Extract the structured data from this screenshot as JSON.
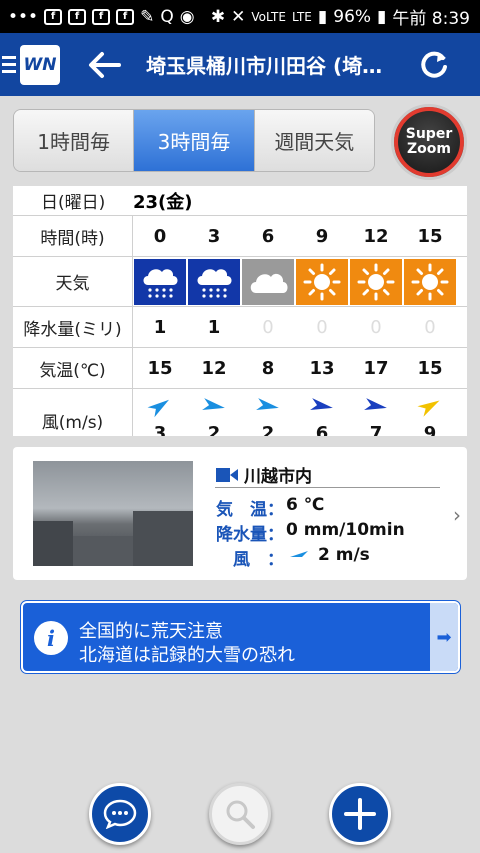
{
  "status_bar": {
    "battery": "96%",
    "time": "午前 8:39",
    "network": "LTE"
  },
  "header": {
    "title": "埼玉県桶川市川田谷 (埼玉…",
    "logo": "WN"
  },
  "tabs": [
    {
      "label": "1時間毎",
      "active": false
    },
    {
      "label": "3時間毎",
      "active": true
    },
    {
      "label": "週間天気",
      "active": false
    }
  ],
  "superzoom": {
    "line1": "Super",
    "line2": "Zoom"
  },
  "forecast": {
    "date_label": "日(曜日)",
    "date_value": "23(金)",
    "hour_label": "時間(時)",
    "hours": [
      "0",
      "3",
      "6",
      "9",
      "12",
      "15"
    ],
    "weather_label": "天気",
    "weather": [
      "rain",
      "rain",
      "cloud",
      "sun",
      "sun",
      "sun"
    ],
    "precip_label": "降水量(ミリ)",
    "precip": [
      "1",
      "1",
      "0",
      "0",
      "0",
      "0"
    ],
    "temp_label": "気温(℃)",
    "temps": [
      "15",
      "12",
      "8",
      "13",
      "17",
      "15"
    ],
    "wind_label": "風(m/s)",
    "wind": [
      "3",
      "2",
      "2",
      "6",
      "7",
      "9"
    ],
    "wind_colors": [
      "#1a8fe0",
      "#1a8fe0",
      "#1a8fe0",
      "#1a3fbf",
      "#1a3fbf",
      "#f2c200"
    ]
  },
  "webcam": {
    "place": "川越市内",
    "temp_label": "気　温：",
    "temp_value": "6 ℃",
    "precip_label": "降水量：",
    "precip_value": "0 mm/10min",
    "wind_label": "風　：",
    "wind_value": "2 m/s"
  },
  "warning": {
    "line1": "全国的に荒天注意",
    "line2": "北海道は記録的大雪の恐れ"
  },
  "colors": {
    "header": "#1246a0",
    "active_tab": "#2e71d6",
    "warning": "#1a60d8"
  }
}
